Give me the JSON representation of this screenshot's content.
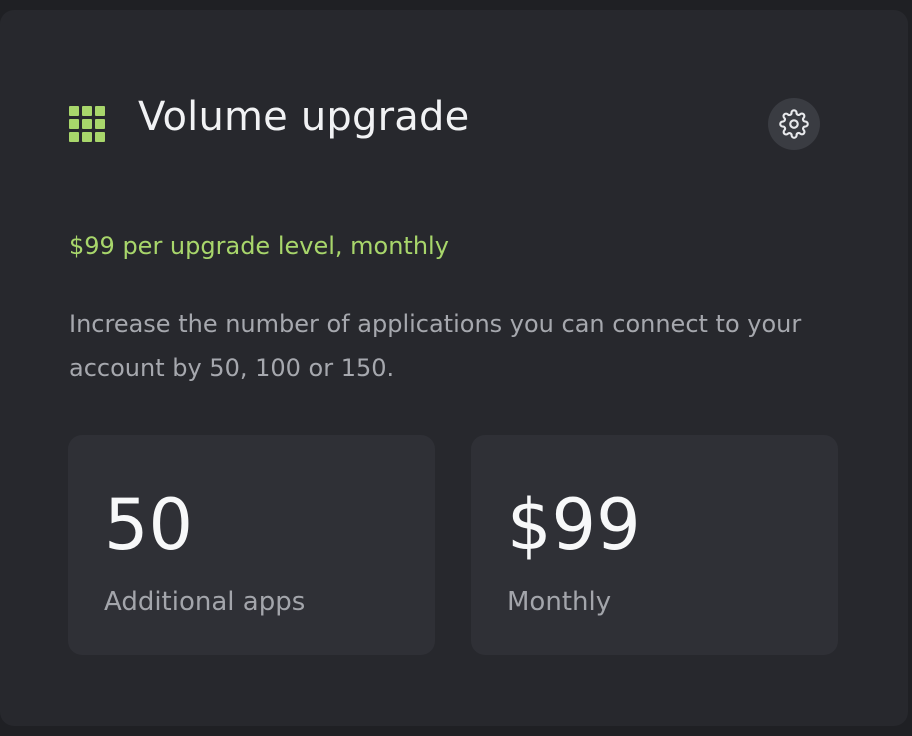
{
  "header": {
    "title": "Volume upgrade",
    "icon": "grid-icon",
    "settings_icon": "gear-icon"
  },
  "pricing": {
    "summary": "$99 per upgrade level, monthly"
  },
  "description": "Increase the number of applications you can connect to your account by 50, 100 or 150.",
  "stats": [
    {
      "value": "50",
      "label": "Additional apps"
    },
    {
      "value": "$99",
      "label": "Monthly"
    }
  ],
  "colors": {
    "accent": "#a8d66b",
    "card_bg": "#27282d",
    "tile_bg": "#2f3036",
    "page_bg": "#1f2024",
    "muted_text": "#a6a8ae"
  }
}
